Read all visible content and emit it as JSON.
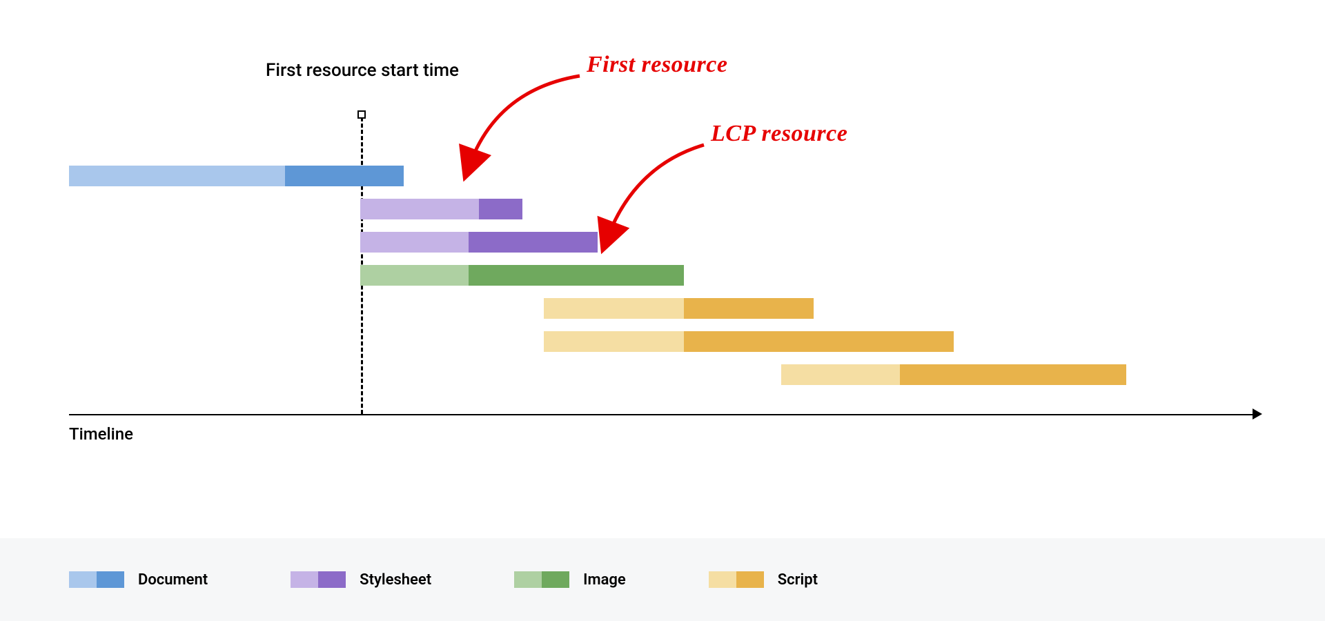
{
  "chart_data": {
    "type": "bar",
    "title": "",
    "xlabel": "Timeline",
    "marker_label": "First resource start time",
    "annotations": [
      "First resource",
      "LCP resource"
    ],
    "legend": [
      {
        "name": "Document",
        "light": "#a9c7ec",
        "dark": "#5e97d6"
      },
      {
        "name": "Stylesheet",
        "light": "#c5b3e6",
        "dark": "#8c6bc8"
      },
      {
        "name": "Image",
        "light": "#aed0a2",
        "dark": "#6fa95e"
      },
      {
        "name": "Script",
        "light": "#f5dea3",
        "dark": "#e8b34b"
      }
    ],
    "marker_x": 27,
    "series": [
      {
        "type": "Document",
        "start": 0,
        "split": 20,
        "end": 31
      },
      {
        "type": "Stylesheet",
        "start": 27,
        "split": 38,
        "end": 42
      },
      {
        "type": "Stylesheet",
        "start": 27,
        "split": 37,
        "end": 49
      },
      {
        "type": "Image",
        "start": 27,
        "split": 37,
        "end": 57
      },
      {
        "type": "Script",
        "start": 44,
        "split": 57,
        "end": 69
      },
      {
        "type": "Script",
        "start": 44,
        "split": 57,
        "end": 82
      },
      {
        "type": "Script",
        "start": 66,
        "split": 77,
        "end": 98
      }
    ]
  }
}
